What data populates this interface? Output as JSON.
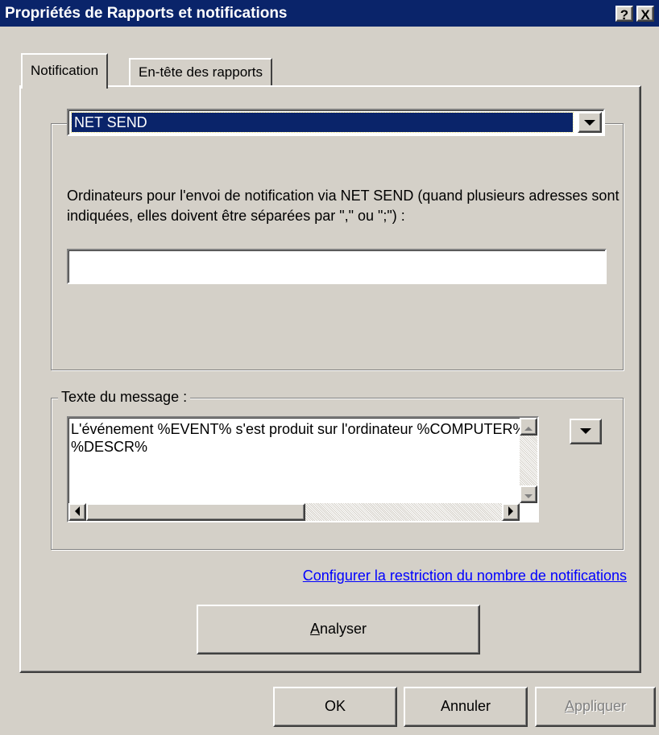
{
  "window": {
    "title": "Propriétés de Rapports et notifications",
    "help_button": "?",
    "close_button": "X"
  },
  "tabs": [
    {
      "label": "Notification",
      "active": true
    },
    {
      "label": "En-tête des rapports",
      "active": false
    }
  ],
  "notification": {
    "method_select": {
      "value": "NET SEND"
    },
    "description": "Ordinateurs pour l'envoi de notification via NET SEND (quand plusieurs adresses sont indiquées, elles doivent être séparées par \",\" ou \";\") :",
    "computers_input": {
      "value": "",
      "placeholder": ""
    },
    "message_group_label": "Texte du message :",
    "message_text": "L'événement %EVENT% s'est produit sur l'ordinateur %COMPUTER%\n%DESCR%",
    "restriction_link": "Configurer la restriction du nombre de notifications",
    "analyser_button": {
      "underline": "A",
      "rest": "nalyser"
    }
  },
  "footer": {
    "ok": "OK",
    "cancel": "Annuler",
    "apply": {
      "underline": "A",
      "rest": "ppliquer",
      "disabled": true
    }
  },
  "colors": {
    "titlebar": "#0a246a",
    "face": "#d4d0c8",
    "selection": "#0a246a",
    "link": "#0000ff"
  }
}
